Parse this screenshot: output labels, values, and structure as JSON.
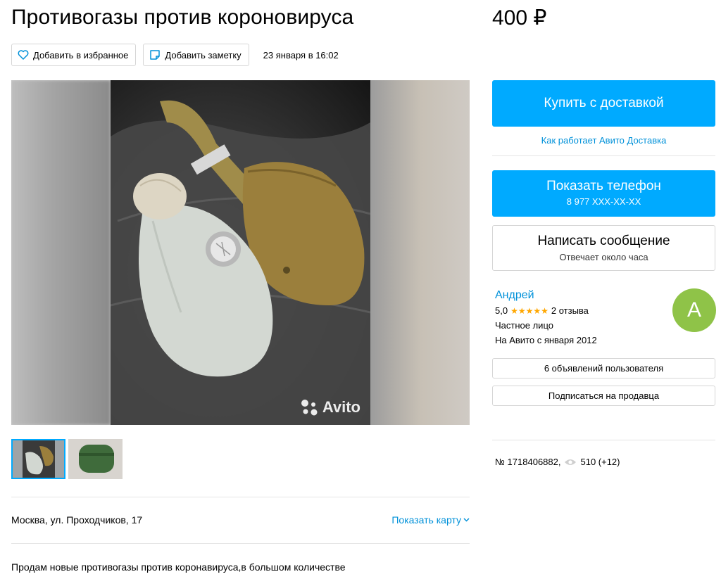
{
  "listing": {
    "title": "Противогазы против короновируса",
    "price": "400 ₽",
    "date": "23 января в 16:02",
    "address": "Москва, ул. Проходчиков, 17",
    "description": "Продам новые противогазы против коронавируса,в большом количестве",
    "number": "№ 1718406882,",
    "views": "510 (+12)"
  },
  "actions": {
    "favorite_label": "Добавить в избранное",
    "note_label": "Добавить заметку",
    "show_map_label": "Показать карту"
  },
  "gallery": {
    "watermark": "Avito",
    "thumbnails": [
      "gas-mask-set",
      "gas-mask-canister"
    ]
  },
  "purchase": {
    "buy_label": "Купить с доставкой",
    "how_link": "Как работает Авито Доставка",
    "phone_label": "Показать телефон",
    "phone_number": "8 977 XXX-XX-XX",
    "message_label": "Написать сообщение",
    "message_sub": "Отвечает около часа"
  },
  "seller": {
    "name": "Андрей",
    "rating": "5,0",
    "stars": "★★★★★",
    "reviews": "2 отзыва",
    "type": "Частное лицо",
    "since": "На Авито с января 2012",
    "avatar_letter": "А",
    "ads_button": "6 объявлений пользователя",
    "subscribe_button": "Подписаться на продавца"
  },
  "colors": {
    "accent": "#00aaff",
    "link": "#0091d9",
    "star": "#ffa700",
    "avatar": "#8fc348"
  }
}
